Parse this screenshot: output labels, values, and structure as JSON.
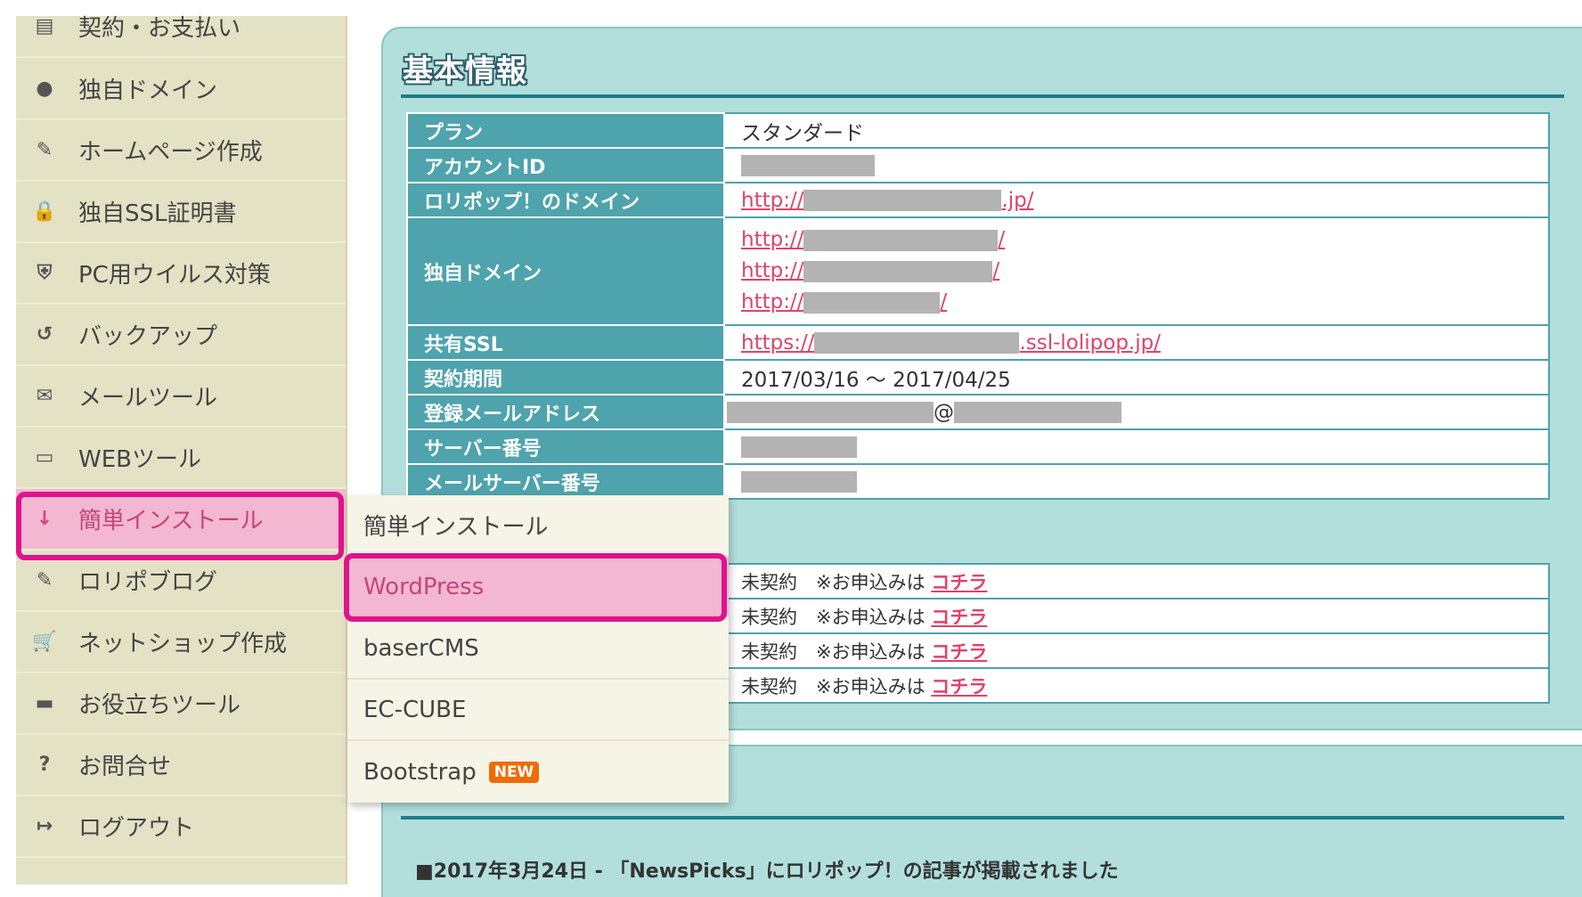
{
  "sidebar": {
    "items": [
      {
        "label": "契約・お支払い",
        "icon": "▤"
      },
      {
        "label": "独自ドメイン",
        "icon": "●"
      },
      {
        "label": "ホームページ作成",
        "icon": "✎"
      },
      {
        "label": "独自SSL証明書",
        "icon": "🔒"
      },
      {
        "label": "PC用ウイルス対策",
        "icon": "⛨"
      },
      {
        "label": "バックアップ",
        "icon": "↺"
      },
      {
        "label": "メールツール",
        "icon": "✉"
      },
      {
        "label": "WEBツール",
        "icon": "▭"
      },
      {
        "label": "簡単インストール",
        "icon": "↓"
      },
      {
        "label": "ロリポブログ",
        "icon": "✎"
      },
      {
        "label": "ネットショップ作成",
        "icon": "🛒"
      },
      {
        "label": "お役立ちツール",
        "icon": "▬"
      },
      {
        "label": "お問合せ",
        "icon": "?"
      },
      {
        "label": "ログアウト",
        "icon": "↦"
      }
    ]
  },
  "submenu": {
    "items": [
      {
        "label": "簡単インストール"
      },
      {
        "label": "WordPress"
      },
      {
        "label": "baserCMS"
      },
      {
        "label": "EC-CUBE"
      },
      {
        "label": "Bootstrap",
        "badge": "NEW"
      }
    ]
  },
  "basic_info": {
    "title": "基本情報",
    "rows": {
      "plan": {
        "label": "プラン",
        "value": "スタンダード"
      },
      "account_id": {
        "label": "アカウントID"
      },
      "lolipop_domain": {
        "label": "ロリポップ！のドメイン",
        "prefix": "http://",
        "suffix": ".jp/"
      },
      "own_domain": {
        "label": "独自ドメイン",
        "links": [
          {
            "prefix": "http://",
            "suffix": "/"
          },
          {
            "prefix": "http://",
            "suffix": "/"
          },
          {
            "prefix": "http://",
            "suffix": "/"
          }
        ]
      },
      "shared_ssl": {
        "label": "共有SSL",
        "prefix": "https://",
        "suffix": ".ssl-lolipop.jp/"
      },
      "contract_period": {
        "label": "契約期間",
        "value": "2017/03/16 ～ 2017/04/25"
      },
      "email": {
        "label": "登録メールアドレス",
        "at": "@"
      },
      "server_no": {
        "label": "サーバー番号"
      },
      "mail_server_no": {
        "label": "メールサーバー番号"
      }
    }
  },
  "options": {
    "rows": [
      {
        "status": "未契約",
        "note": "※お申込みは",
        "link": "コチラ"
      },
      {
        "status": "未契約",
        "note": "※お申込みは",
        "link": "コチラ"
      },
      {
        "status": "未契約",
        "note": "※お申込みは",
        "link": "コチラ"
      },
      {
        "status": "未契約",
        "note": "※お申込みは",
        "link": "コチラ"
      }
    ]
  },
  "news": {
    "headline": "■2017年3月24日 - 「NewsPicks」にロリポップ！の記事が掲載されました"
  },
  "colors": {
    "highlight_border": "#e0138c",
    "active_bg": "#f3b7d1",
    "panel_bg": "#b2dfdc",
    "table_header": "#4ea3ad",
    "link": "#e0436a",
    "sidebar_bg": "#e3e2c4",
    "badge": "#ef6c00"
  }
}
